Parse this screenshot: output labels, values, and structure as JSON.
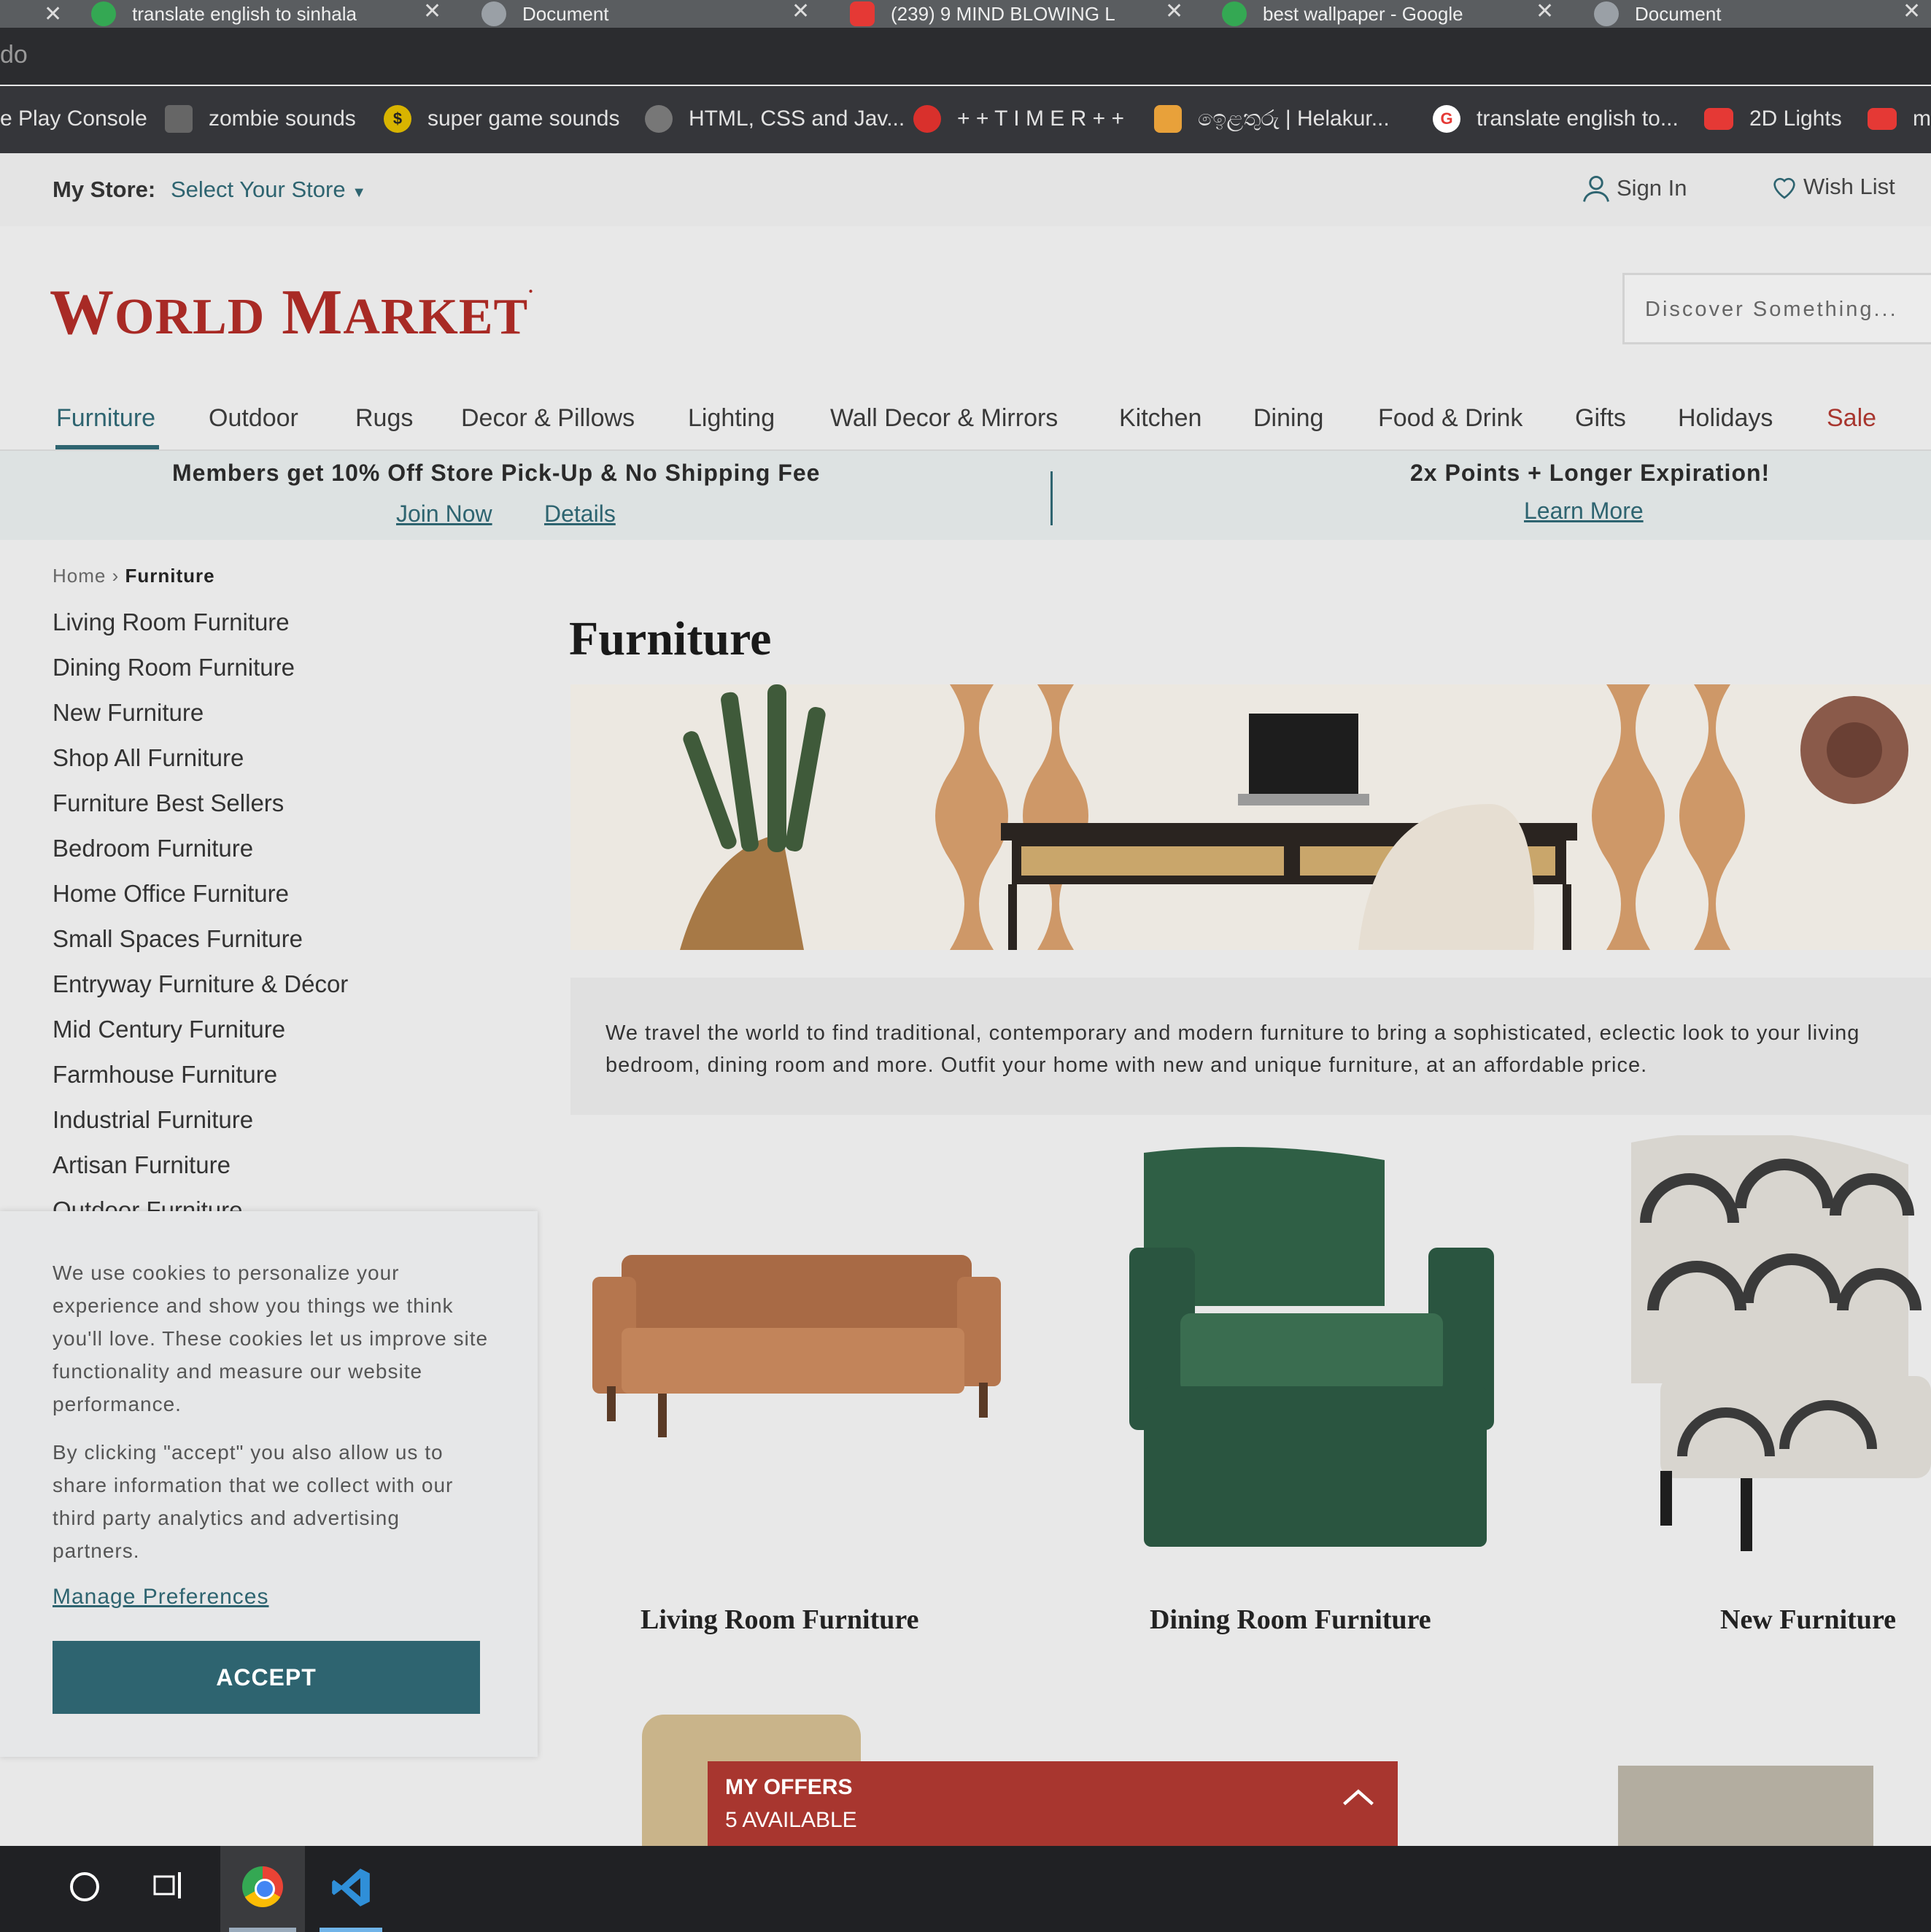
{
  "browser": {
    "tabs": [
      {
        "title": "translate english to sinhala",
        "icon_color": "#34a853"
      },
      {
        "title": "Document",
        "icon_color": "#9aa0a6"
      },
      {
        "title": "(239) 9 MIND BLOWING L",
        "icon_color": "#e53935"
      },
      {
        "title": "best wallpaper - Google",
        "icon_color": "#34a853"
      },
      {
        "title": "Document",
        "icon_color": "#9aa0a6"
      }
    ],
    "address": "do",
    "bookmarks": [
      {
        "label": "e Play Console",
        "icon": "none",
        "color": ""
      },
      {
        "label": "zombie sounds",
        "icon": "zombie-icon",
        "color": "#666666"
      },
      {
        "label": "super game sounds",
        "icon": "dollar-icon",
        "color": "#d8b400",
        "glyph": "$"
      },
      {
        "label": "HTML, CSS and Jav...",
        "icon": "globe-icon",
        "color": "#777777"
      },
      {
        "label": "+ + T I M E R + +",
        "icon": "timer-icon",
        "color": "#d9302c"
      },
      {
        "label": "ඉෙළතුරු | Helakur...",
        "icon": "helakuru-icon",
        "color": "#e8a13a"
      },
      {
        "label": "translate english to...",
        "icon": "google-icon",
        "color": "#ffffff",
        "glyph": "G"
      },
      {
        "label": "2D Lights",
        "icon": "youtube-icon",
        "color": "#e53935"
      },
      {
        "label": "m",
        "icon": "youtube-icon",
        "color": "#e53935"
      }
    ]
  },
  "utility": {
    "store_label": "My Store:",
    "store_select": "Select Your Store",
    "sign_in": "Sign In",
    "wish_list": "Wish List"
  },
  "header": {
    "logo_w": "W",
    "logo_orld": "ORLD",
    "logo_m": "M",
    "logo_arket": "ARKET",
    "search_placeholder": "Discover Something..."
  },
  "nav": [
    "Furniture",
    "Outdoor",
    "Rugs",
    "Decor & Pillows",
    "Lighting",
    "Wall Decor & Mirrors",
    "Kitchen",
    "Dining",
    "Food & Drink",
    "Gifts",
    "Holidays",
    "Sale"
  ],
  "promo": {
    "left_text": "Members get 10% Off Store Pick-Up & No Shipping Fee",
    "join": "Join Now",
    "details": "Details",
    "right_text": "2x Points + Longer Expiration!",
    "learn": "Learn More"
  },
  "breadcrumb": {
    "home": "Home",
    "sep": "›",
    "current": "Furniture"
  },
  "sidebar": [
    "Living Room Furniture",
    "Dining Room Furniture",
    "New Furniture",
    "Shop All Furniture",
    "Furniture Best Sellers",
    "Bedroom Furniture",
    "Home Office Furniture",
    "Small Spaces Furniture",
    "Entryway Furniture & Décor",
    "Mid Century Furniture",
    "Farmhouse Furniture",
    "Industrial Furniture",
    "Artisan Furniture",
    "Outdoor Furniture"
  ],
  "main": {
    "title": "Furniture",
    "description": "We travel the world to find traditional, contemporary and modern furniture to bring a sophisticated, eclectic look to your living bedroom, dining room and more. Outfit your home with new and unique furniture, at an affordable price.",
    "categories": [
      "Living Room Furniture",
      "Dining Room Furniture",
      "New Furniture"
    ]
  },
  "cookie": {
    "p1": "We use cookies to personalize your experience and show you things we think you'll love. These cookies let us improve site functionality and measure our website performance.",
    "p2": "By clicking \"accept\" you also allow us to share information that we collect with our third party analytics and advertising partners.",
    "manage": "Manage Preferences",
    "accept": "ACCEPT"
  },
  "offers": {
    "title": "MY OFFERS",
    "count": "5 AVAILABLE"
  },
  "colors": {
    "brand_red": "#a82a25",
    "teal": "#2e6470",
    "offers_red": "#a8362f",
    "sale": "#a8362f"
  }
}
